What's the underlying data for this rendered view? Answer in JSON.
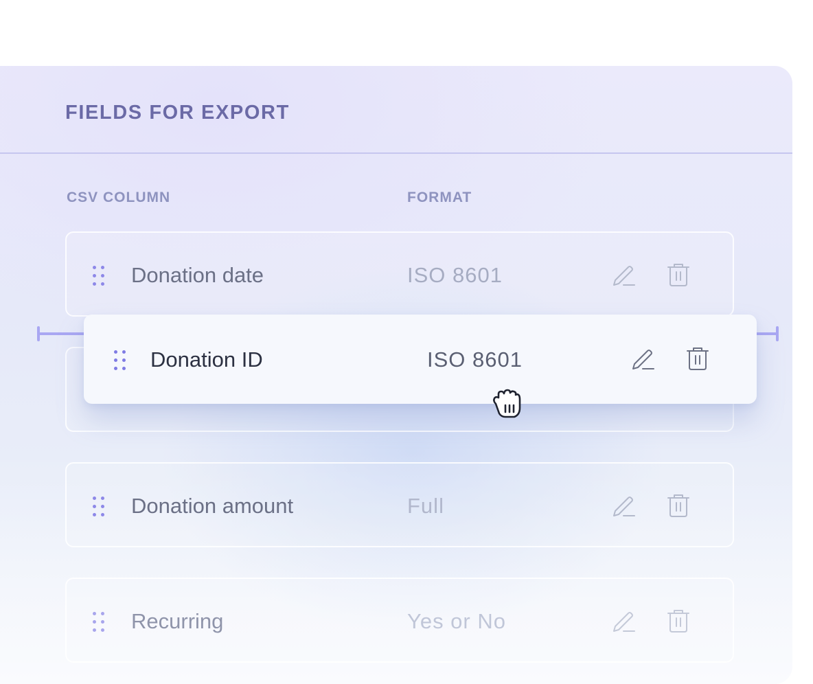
{
  "panel": {
    "title": "FIELDS FOR EXPORT"
  },
  "columns": {
    "csv_column": "CSV COLUMN",
    "format": "FORMAT"
  },
  "rows": [
    {
      "name": "Donation date",
      "format": "ISO 8601"
    },
    {
      "name": "",
      "format": ""
    },
    {
      "name": "Donation amount",
      "format": "Full"
    },
    {
      "name": "Recurring",
      "format": "Yes or No"
    }
  ],
  "dragging": {
    "name": "Donation ID",
    "format": "ISO 8601"
  },
  "icons": {
    "handle": "drag-handle-icon",
    "edit": "pencil-icon",
    "delete": "trash-icon",
    "cursor": "grab-hand-cursor-icon"
  },
  "colors": {
    "accent": "#8d88e8",
    "title": "#6b6aa6",
    "drop_indicator": "#a9a7f2"
  }
}
